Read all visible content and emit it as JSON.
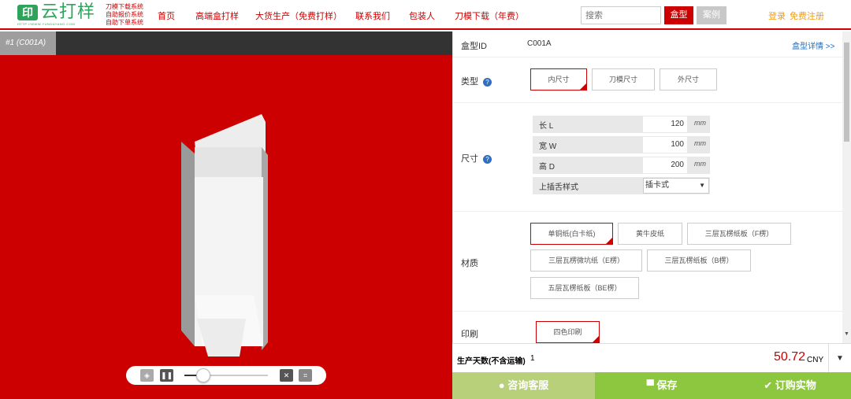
{
  "header": {
    "logo_mark": "印",
    "logo_name": "云打样",
    "logo_url": "HTTP://WWW.YUNDAYANG.COM",
    "logo_tags": [
      "刀模下载系统",
      "自助报价系统",
      "自助下单系统"
    ],
    "nav": [
      "首页",
      "高端盒打样",
      "大货生产（免费打样）",
      "联系我们",
      "包装人",
      "刀模下载（年费）"
    ],
    "search_placeholder": "搜索",
    "btn_box": "盒型",
    "btn_case": "案例",
    "login": "登录",
    "register": "免费注册"
  },
  "viewer": {
    "tab_label": "#1 (C001A)"
  },
  "panel": {
    "id_label": "盒型ID",
    "id_value": "C001A",
    "detail_link": "盒型详情 >>",
    "type_label": "类型",
    "type_options": [
      "内尺寸",
      "刀模尺寸",
      "外尺寸"
    ],
    "size_label": "尺寸",
    "dims": [
      {
        "name": "长 L",
        "value": "120",
        "unit": "mm"
      },
      {
        "name": "宽 W",
        "value": "100",
        "unit": "mm"
      },
      {
        "name": "高 D",
        "value": "200",
        "unit": "mm"
      }
    ],
    "tongue_label": "上插舌样式",
    "tongue_value": "插卡式",
    "material_label": "材质",
    "materials": [
      "单铜纸(白卡纸)",
      "黄牛皮纸",
      "三层瓦楞纸板（F楞）",
      "三层瓦楞微坑纸（E楞）",
      "三层瓦楞纸板（B楞）",
      "五层瓦楞纸板（BE楞）"
    ],
    "print_label": "印刷",
    "print_options": [
      "四色印刷"
    ]
  },
  "footer": {
    "days_label": "生产天数(不含运输)",
    "days_value": "1",
    "price": "50.72",
    "currency": "CNY",
    "btn_consult": "咨询客服",
    "btn_save": "保存",
    "btn_order": "订购实物"
  },
  "colors": {
    "brand_red": "#cc0000",
    "brand_green": "#2fa35b",
    "action_green": "#8dc63f"
  }
}
